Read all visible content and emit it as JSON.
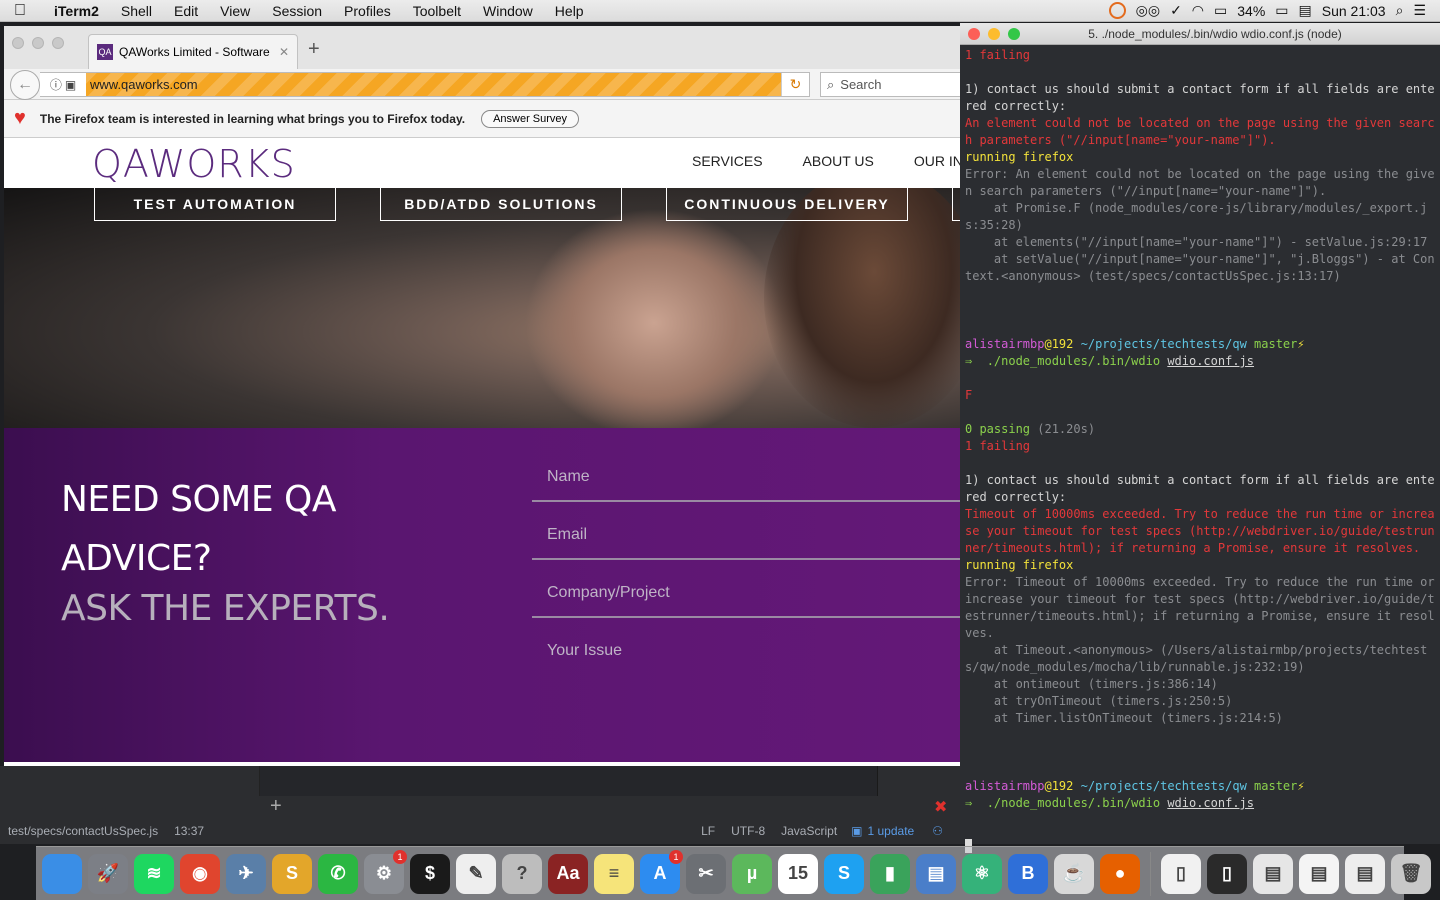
{
  "menubar": {
    "app": "iTerm2",
    "items": [
      "Shell",
      "Edit",
      "View",
      "Session",
      "Profiles",
      "Toolbelt",
      "Window",
      "Help"
    ],
    "battery": "34%",
    "clock": "Sun 21:03"
  },
  "browser": {
    "tab_title": "QAWorks Limited - Software",
    "url": "www.qaworks.com",
    "search_placeholder": "Search",
    "notification": "The Firefox team is interested in learning what brings you to Firefox today.",
    "survey_button": "Answer Survey"
  },
  "site": {
    "logo": "QAWORKS",
    "nav": [
      "SERVICES",
      "ABOUT US",
      "OUR INSIGH"
    ],
    "services": [
      "TEST AUTOMATION",
      "BDD/ATDD SOLUTIONS",
      "CONTINUOUS DELIVERY"
    ],
    "headline_1": "NEED SOME QA",
    "headline_2": "ADVICE?",
    "headline_3": "ASK THE EXPERTS.",
    "fields": [
      "Name",
      "Email",
      "Company/Project",
      "Your Issue"
    ]
  },
  "editor_status": {
    "file": "test/specs/contactUsSpec.js",
    "cursor": "13:37",
    "eol": "LF",
    "encoding": "UTF-8",
    "grammar": "JavaScript",
    "update": "1 update"
  },
  "iterm": {
    "title": "5. ./node_modules/.bin/wdio wdio.conf.js (node)",
    "lines": [
      {
        "c": "red",
        "t": "1 failing"
      },
      {
        "c": "",
        "t": " "
      },
      {
        "c": "",
        "t": "1) contact us should submit a contact form if all fields are entered correctly:"
      },
      {
        "c": "red",
        "t": "An element could not be located on the page using the given search parameters (\"//input[name=\"your-name\"]\")."
      },
      {
        "c": "yel",
        "t": "running firefox"
      },
      {
        "c": "gray",
        "t": "Error: An element could not be located on the page using the given search parameters (\"//input[name=\"your-name\"]\")."
      },
      {
        "c": "gray",
        "t": "    at Promise.F (node_modules/core-js/library/modules/_export.js:35:28)"
      },
      {
        "c": "gray",
        "t": "    at elements(\"//input[name=\"your-name\"]\") - setValue.js:29:17"
      },
      {
        "c": "gray",
        "t": "    at setValue(\"//input[name=\"your-name\"]\", \"j.Bloggs\") - at Context.<anonymous> (test/specs/contactUsSpec.js:13:17)"
      },
      {
        "c": "",
        "t": " "
      },
      {
        "c": "",
        "t": " "
      },
      {
        "c": "",
        "t": " "
      },
      {
        "c": "prompt",
        "t": ""
      },
      {
        "c": "cmd",
        "t": ""
      },
      {
        "c": "",
        "t": " "
      },
      {
        "c": "red",
        "t": "F"
      },
      {
        "c": "",
        "t": " "
      },
      {
        "c": "pass",
        "t": ""
      },
      {
        "c": "red",
        "t": "1 failing"
      },
      {
        "c": "",
        "t": " "
      },
      {
        "c": "",
        "t": "1) contact us should submit a contact form if all fields are entered correctly:"
      },
      {
        "c": "red",
        "t": "Timeout of 10000ms exceeded. Try to reduce the run time or increase your timeout for test specs (http://webdriver.io/guide/testrunner/timeouts.html); if returning a Promise, ensure it resolves."
      },
      {
        "c": "yel",
        "t": "running firefox"
      },
      {
        "c": "gray",
        "t": "Error: Timeout of 10000ms exceeded. Try to reduce the run time or increase your timeout for test specs (http://webdriver.io/guide/testrunner/timeouts.html); if returning a Promise, ensure it resolves."
      },
      {
        "c": "gray",
        "t": "    at Timeout.<anonymous> (/Users/alistairmbp/projects/techtests/qw/node_modules/mocha/lib/runnable.js:232:19)"
      },
      {
        "c": "gray",
        "t": "    at ontimeout (timers.js:386:14)"
      },
      {
        "c": "gray",
        "t": "    at tryOnTimeout (timers.js:250:5)"
      },
      {
        "c": "gray",
        "t": "    at Timer.listOnTimeout (timers.js:214:5)"
      },
      {
        "c": "",
        "t": " "
      },
      {
        "c": "",
        "t": " "
      },
      {
        "c": "",
        "t": " "
      },
      {
        "c": "prompt",
        "t": ""
      },
      {
        "c": "cmd",
        "t": ""
      },
      {
        "c": "",
        "t": " "
      },
      {
        "c": "cursor",
        "t": ""
      }
    ],
    "prompt": {
      "user": "alistairmbp",
      "host": "@192",
      "path": "~/projects/techtests/qw",
      "branch": "master",
      "bolt": "⚡"
    },
    "command": {
      "arrow": "⇒",
      "exe": "./node_modules/.bin/wdio",
      "arg": "wdio.conf.js"
    },
    "passing": {
      "count": "0 passing",
      "time": "(21.20s)"
    }
  },
  "dock": {
    "apps": [
      {
        "name": "finder-icon",
        "color": "#3a8ee6",
        "glyph": ""
      },
      {
        "name": "launchpad-icon",
        "color": "#7c7f86",
        "glyph": "🚀"
      },
      {
        "name": "spotify-icon",
        "color": "#1ed760",
        "glyph": "≋"
      },
      {
        "name": "chrome-icon",
        "color": "#e0452e",
        "glyph": "◉"
      },
      {
        "name": "preview-icon",
        "color": "#5a7fa8",
        "glyph": "✈"
      },
      {
        "name": "slack-icon",
        "color": "#e3a62a",
        "glyph": "S"
      },
      {
        "name": "whatsapp-icon",
        "color": "#2bb742",
        "glyph": "✆"
      },
      {
        "name": "system-preferences-icon",
        "color": "#8a8d93",
        "glyph": "⚙",
        "badge": "1"
      },
      {
        "name": "terminal-icon",
        "color": "#1a1a1a",
        "glyph": "$"
      },
      {
        "name": "textedit-icon",
        "color": "#eeeeee",
        "glyph": "✎"
      },
      {
        "name": "help-icon",
        "color": "#bdbdbd",
        "glyph": "?"
      },
      {
        "name": "dictionary-icon",
        "color": "#8a2323",
        "glyph": "Aa"
      },
      {
        "name": "notes-icon",
        "color": "#f6e47a",
        "glyph": "≡"
      },
      {
        "name": "app-store-icon",
        "color": "#2d8cf0",
        "glyph": "A",
        "badge": "1"
      },
      {
        "name": "utilities-icon",
        "color": "#6c6f74",
        "glyph": "✂"
      },
      {
        "name": "utorrent-icon",
        "color": "#5cb85c",
        "glyph": "µ"
      },
      {
        "name": "calendar-icon",
        "color": "#ffffff",
        "glyph": "15"
      },
      {
        "name": "skype-icon",
        "color": "#1ea1f1",
        "glyph": "S"
      },
      {
        "name": "numbers-icon",
        "color": "#3aa35b",
        "glyph": "▮"
      },
      {
        "name": "keynote-icon",
        "color": "#4a7ec9",
        "glyph": "▤"
      },
      {
        "name": "atom-icon",
        "color": "#35b27a",
        "glyph": "⚛"
      },
      {
        "name": "bbedit-icon",
        "color": "#2f6fd8",
        "glyph": "B"
      },
      {
        "name": "java-icon",
        "color": "#d8d8d8",
        "glyph": "☕"
      },
      {
        "name": "firefox-icon",
        "color": "#e66000",
        "glyph": "●"
      }
    ],
    "stack": [
      {
        "name": "docx-file-icon",
        "color": "#f1f1f1",
        "glyph": "▯"
      },
      {
        "name": "iterm-file-icon",
        "color": "#2a2a2a",
        "glyph": "▯"
      },
      {
        "name": "screenshot-file-icon",
        "color": "#e6e6e6",
        "glyph": "▤"
      },
      {
        "name": "document-file-icon",
        "color": "#f4f4f4",
        "glyph": "▤"
      },
      {
        "name": "downloads-stack-icon",
        "color": "#ededed",
        "glyph": "▤"
      },
      {
        "name": "trash-icon",
        "color": "#c8c8c8",
        "glyph": "🗑"
      }
    ]
  }
}
